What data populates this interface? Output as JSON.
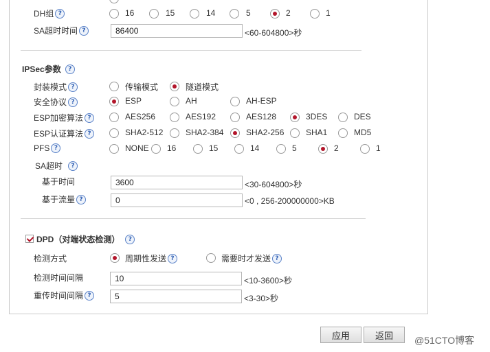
{
  "dh": {
    "label": "DH组",
    "options": [
      "16",
      "15",
      "14",
      "5",
      "2",
      "1"
    ],
    "selected": "2"
  },
  "sa_timeout": {
    "label": "SA超时时间",
    "value": "86400",
    "hint": "<60-604800>秒"
  },
  "ipsec": {
    "title": "IPSec参数",
    "encap": {
      "label": "封装模式",
      "options": [
        "传输模式",
        "隧道模式"
      ],
      "selected": "隧道模式"
    },
    "protocol": {
      "label": "安全协议",
      "options": [
        "ESP",
        "AH",
        "AH-ESP"
      ],
      "selected": "ESP"
    },
    "esp_enc": {
      "label": "ESP加密算法",
      "options": [
        "AES256",
        "AES192",
        "AES128",
        "3DES",
        "DES"
      ],
      "selected": "3DES"
    },
    "esp_auth": {
      "label": "ESP认证算法",
      "options": [
        "SHA2-512",
        "SHA2-384",
        "SHA2-256",
        "SHA1",
        "MD5"
      ],
      "selected": "SHA2-256"
    },
    "pfs": {
      "label": "PFS",
      "options": [
        "NONE",
        "16",
        "15",
        "14",
        "5",
        "2",
        "1"
      ],
      "selected": "2"
    },
    "sa_timeout_label": "SA超时",
    "time": {
      "label": "基于时间",
      "value": "3600",
      "hint": "<30-604800>秒"
    },
    "traffic": {
      "label": "基于流量",
      "value": "0",
      "hint": "<0 , 256-200000000>KB"
    }
  },
  "dpd": {
    "title": "DPD（对端状态检测）",
    "checked": true,
    "mode": {
      "label": "检测方式",
      "options": [
        "周期性发送",
        "需要时才发送"
      ],
      "selected": "周期性发送"
    },
    "interval": {
      "label": "检测时间间隔",
      "value": "10",
      "hint": "<10-3600>秒"
    },
    "retry": {
      "label": "重传时间间隔",
      "value": "5",
      "hint": "<3-30>秒"
    }
  },
  "buttons": {
    "apply": "应用",
    "back": "返回"
  },
  "watermark": "@51CTO博客"
}
